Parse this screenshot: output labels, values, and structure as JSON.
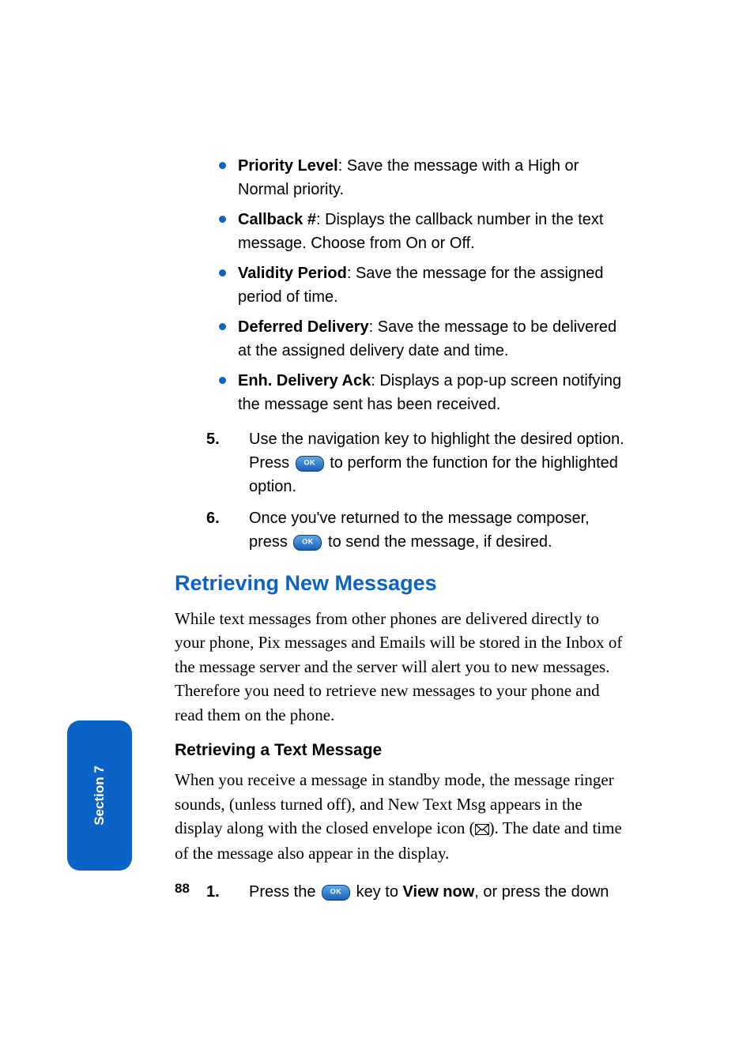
{
  "bullets": [
    {
      "term": "Priority Level",
      "desc": ": Save the message with a High or Normal priority."
    },
    {
      "term": "Callback #",
      "desc": ": Displays the callback number in the text message. Choose from On or Off."
    },
    {
      "term": "Validity Period",
      "desc": ": Save the message for the assigned period of time."
    },
    {
      "term": "Deferred Delivery",
      "desc": ": Save the message to be delivered at the assigned delivery date and time."
    },
    {
      "term": "Enh. Delivery Ack",
      "desc": ": Displays a pop-up screen notifying the message sent has been received."
    }
  ],
  "steps": [
    {
      "num": "5.",
      "before": "Use the navigation key to highlight the desired option. Press ",
      "after": " to perform the function for the highlighted option."
    },
    {
      "num": "6.",
      "before": "Once you've returned to the message composer, press ",
      "after": " to send the message, if desired."
    }
  ],
  "heading": "Retrieving New Messages",
  "para1": "While text messages from other phones are delivered directly to your phone, Pix messages and Emails will be stored in the Inbox of the message server and the server will alert you to new messages. Therefore you need to retrieve new messages to your phone and read them on the phone.",
  "subheading": "Retrieving a Text Message",
  "para2_a": "When you receive a message in standby mode, the message ringer sounds, (unless turned off), and New Text Msg appears in the display along with the closed envelope icon (",
  "para2_b": "). The date and time of the message also appear in the display.",
  "step2": {
    "num": "1.",
    "before": "Press the ",
    "mid": " key to ",
    "bold": "View now",
    "after": ", or press the down"
  },
  "tab": "Section 7",
  "pagenum": "88"
}
